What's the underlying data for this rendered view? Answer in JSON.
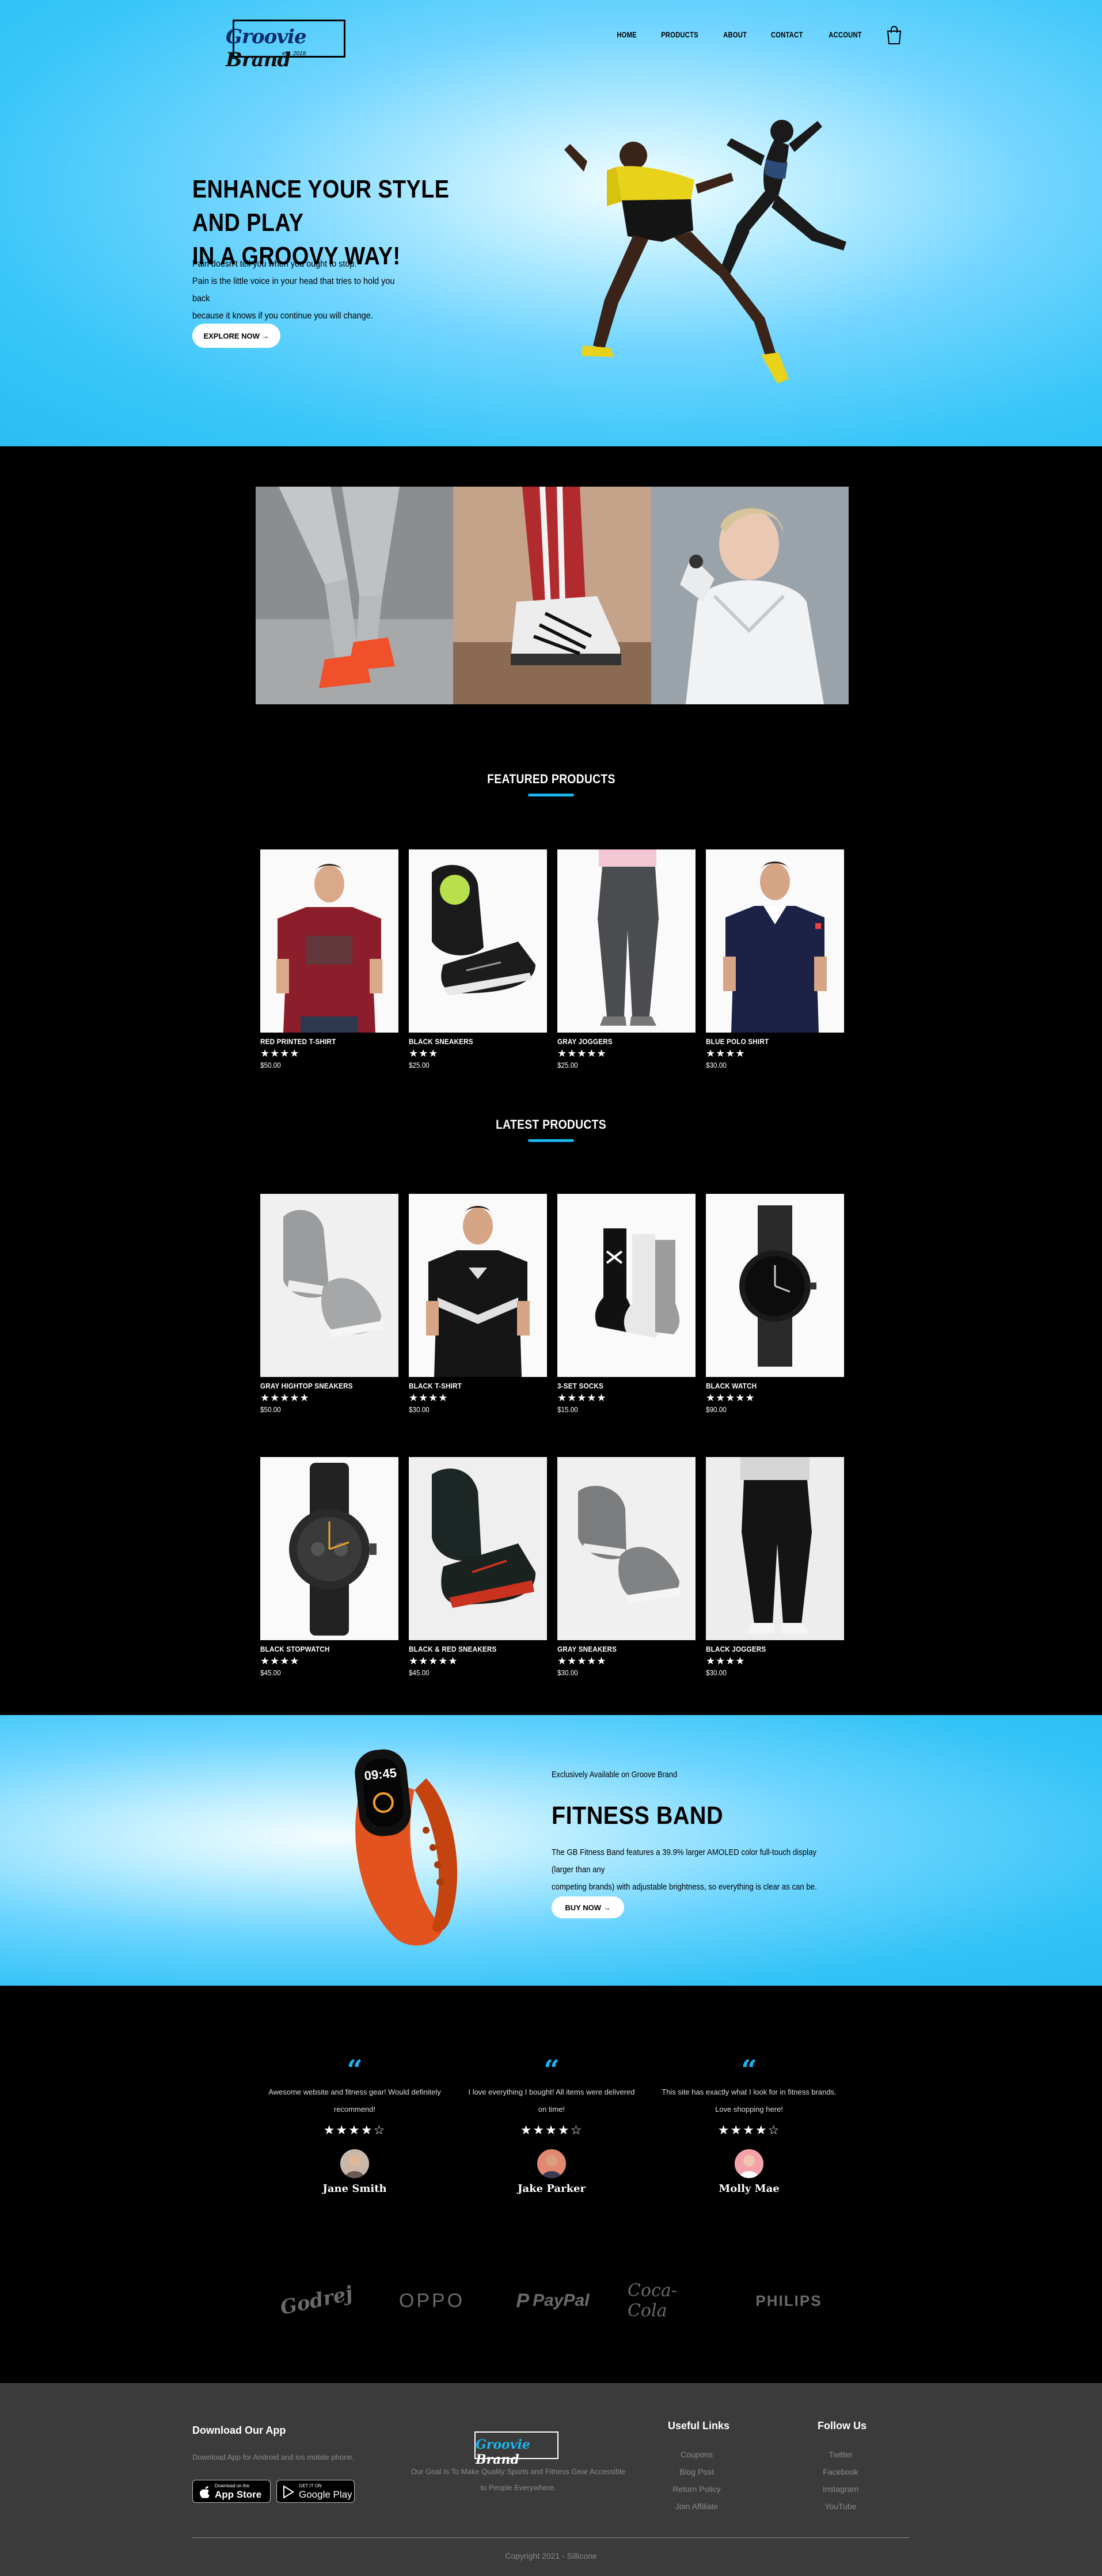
{
  "site": {
    "logo_text": "Groovie",
    "logo_brand": "Brand",
    "logo_est": "est. 2018"
  },
  "nav": {
    "items": [
      "HOME",
      "PRODUCTS",
      "ABOUT",
      "CONTACT",
      "ACCOUNT"
    ],
    "cart_icon": "shopping-bag-icon"
  },
  "hero": {
    "title_line1": "ENHANCE YOUR STYLE AND PLAY",
    "title_line2": "IN A GROOVY WAY!",
    "sub_line1": "Pain doesn't tell you when you ought to stop.",
    "sub_line2": "Pain is the little voice in your head that tries to hold you back",
    "sub_line3": "because it knows if you continue you will change.",
    "cta": "EXPLORE NOW →"
  },
  "featured": {
    "title": "FEATURED PRODUCTS",
    "products": [
      {
        "name": "RED PRINTED T-SHIRT",
        "rating": 4,
        "stars": "★★★★",
        "price": "$50.00"
      },
      {
        "name": "BLACK SNEAKERS",
        "rating": 3,
        "stars": "★★★",
        "price": "$25.00"
      },
      {
        "name": "GRAY JOGGERS",
        "rating": 5,
        "stars": "★★★★★",
        "price": "$25.00"
      },
      {
        "name": "BLUE POLO SHIRT",
        "rating": 4,
        "stars": "★★★★",
        "price": "$30.00"
      }
    ]
  },
  "latest": {
    "title": "LATEST PRODUCTS",
    "products": [
      {
        "name": "GRAY HIGHTOP SNEAKERS",
        "rating": 5,
        "stars": "★★★★★",
        "price": "$50.00"
      },
      {
        "name": "BLACK T-SHIRT",
        "rating": 4,
        "stars": "★★★★",
        "price": "$30.00"
      },
      {
        "name": "3-SET SOCKS",
        "rating": 5,
        "stars": "★★★★★",
        "price": "$15.00"
      },
      {
        "name": "BLACK WATCH",
        "rating": 5,
        "stars": "★★★★★",
        "price": "$90.00"
      },
      {
        "name": "BLACK STOPWATCH",
        "rating": 4,
        "stars": "★★★★",
        "price": "$45.00"
      },
      {
        "name": "BLACK & RED SNEAKERS",
        "rating": 5,
        "stars": "★★★★★",
        "price": "$45.00"
      },
      {
        "name": "GRAY SNEAKERS",
        "rating": 5,
        "stars": "★★★★★",
        "price": "$30.00"
      },
      {
        "name": "BLACK JOGGERS",
        "rating": 4,
        "stars": "★★★★",
        "price": "$30.00"
      }
    ]
  },
  "band": {
    "eyebrow": "Exclusively Available on Groove Brand",
    "title": "FITNESS BAND",
    "desc_line1": "The GB Fitness Band features a 39.9% larger AMOLED color full-touch display (larger than any",
    "desc_line2": "competing brands) with adjustable brightness, so everything is clear as can be.",
    "cta": "BUY NOW →",
    "screen_time": "09:45"
  },
  "testimonials": [
    {
      "text1": "Awesome website and fitness gear! Would definitely",
      "text2": "recommend!",
      "rating": 4,
      "stars": "★★★★☆",
      "name": "Jane Smith"
    },
    {
      "text1": "I love everything I bought! All items were delivered",
      "text2": "on time!",
      "rating": 4,
      "stars": "★★★★☆",
      "name": "Jake Parker"
    },
    {
      "text1": "This site has exactly what I look for in fitness brands.",
      "text2": "Love shopping here!",
      "rating": 4,
      "stars": "★★★★☆",
      "name": "Molly Mae"
    }
  ],
  "brands": [
    "Godrej",
    "OPPO",
    "PayPal",
    "Coca-Cola",
    "PHILIPS"
  ],
  "footer": {
    "app_title": "Download Our App",
    "app_text": "Download App for Android and ios mobile phone.",
    "appstore_small": "Download on the",
    "appstore_big": "App Store",
    "play_small": "GET IT ON",
    "play_big": "Google Play",
    "mission_line1": "Our Goal Is To Make Quality Sports and Fitness Gear Accessible",
    "mission_line2": "to People Everywhere.",
    "links_title": "Useful Links",
    "links": [
      "Coupons",
      "Blog Post",
      "Return Policy",
      "Join Affiliate"
    ],
    "follow_title": "Follow Us",
    "social": [
      "Twitter",
      "Facebook",
      "Instagram",
      "YouTube"
    ],
    "copyright": "Copyright 2021 - Sillicone"
  },
  "colors": {
    "accent": "#1ab5ee",
    "hero_blue": "#38c6f8",
    "footer_bg": "#3b3b3b"
  }
}
